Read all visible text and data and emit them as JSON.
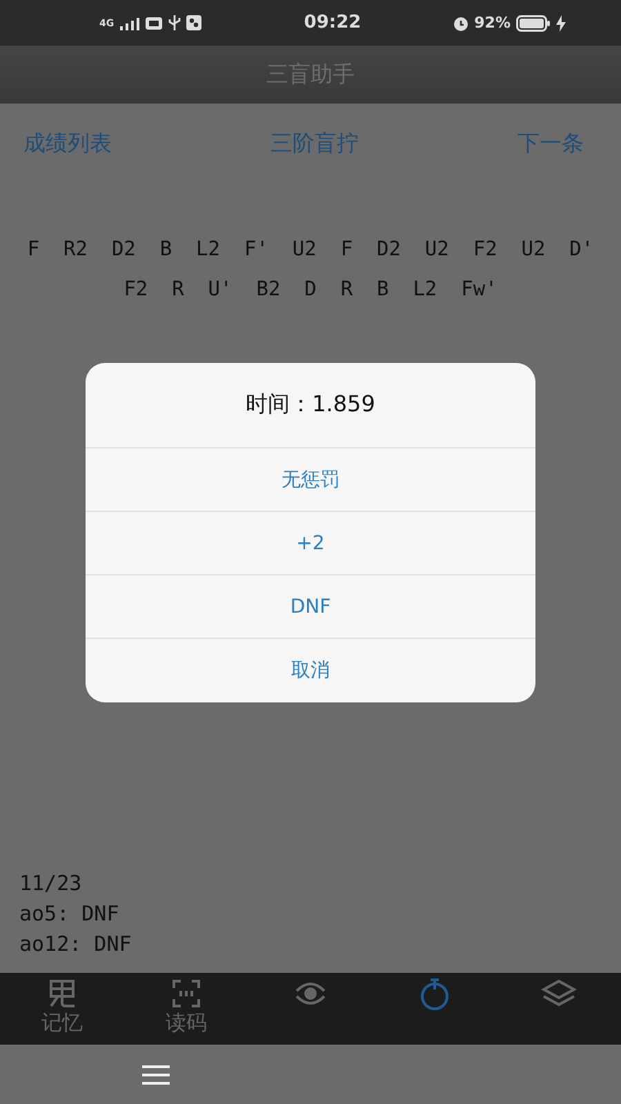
{
  "status_bar": {
    "network": "4G",
    "time": "09:22",
    "battery": "92%"
  },
  "title_bar": {
    "title": "三盲助手"
  },
  "toolbar": {
    "left": "成绩列表",
    "center": "三阶盲拧",
    "right": "下一条"
  },
  "scramble": "F  R2  D2  B  L2  F'  U2  F  D2  U2  F2  U2  D'  F2  R  U'  B2  D  R  B  L2  Fw'",
  "stats": [
    "11/23",
    "ao5: DNF",
    "ao12: DNF"
  ],
  "dialog": {
    "title": "时间：1.859",
    "options": [
      "无惩罚",
      "+2",
      "DNF",
      "取消"
    ]
  },
  "tabs": [
    {
      "kind": "memory",
      "label": "记忆",
      "selected": false
    },
    {
      "kind": "code",
      "label": "读码",
      "selected": false
    },
    {
      "kind": "eye",
      "selected": false
    },
    {
      "kind": "timer",
      "selected": true
    },
    {
      "kind": "layers",
      "selected": false
    }
  ]
}
